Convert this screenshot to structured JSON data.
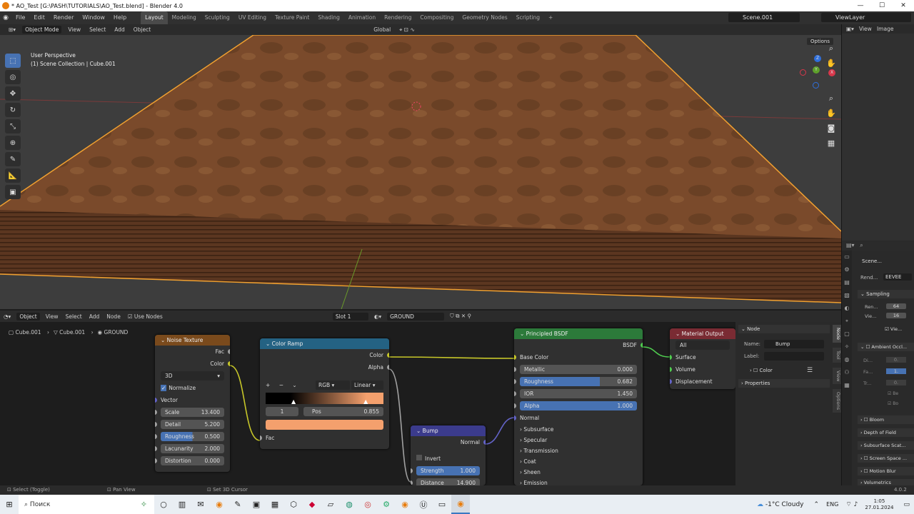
{
  "window": {
    "title": "* AO_Test [G:\\PASH\\TUTORIALS\\AO_Test.blend] - Blender 4.0",
    "min": "—",
    "max": "☐",
    "close": "✕"
  },
  "menu": [
    "File",
    "Edit",
    "Render",
    "Window",
    "Help"
  ],
  "workspaces": [
    "Layout",
    "Modeling",
    "Sculpting",
    "UV Editing",
    "Texture Paint",
    "Shading",
    "Animation",
    "Rendering",
    "Compositing",
    "Geometry Nodes",
    "Scripting",
    "+"
  ],
  "scene": "Scene.001",
  "viewlayer": "ViewLayer",
  "viewport": {
    "mode": "Object Mode",
    "menus": [
      "View",
      "Select",
      "Add",
      "Object"
    ],
    "transform": "Global",
    "options": "Options",
    "perspective": "User Perspective",
    "collection": "(1) Scene Collection | Cube.001"
  },
  "gizmo": {
    "x": "X",
    "y": "Y",
    "z": "Z"
  },
  "nodeeditor": {
    "editor_type": "Object",
    "menus": [
      "View",
      "Select",
      "Add",
      "Node"
    ],
    "use_nodes": "Use Nodes",
    "slot": "Slot 1",
    "material": "GROUND",
    "breadcrumb": [
      "Cube.001",
      "Cube.001",
      "GROUND"
    ]
  },
  "noise": {
    "title": "Noise Texture",
    "out_fac": "Fac",
    "out_color": "Color",
    "dim": "3D",
    "normalize": "Normalize",
    "vector": "Vector",
    "fields": [
      {
        "label": "Scale",
        "value": "13.400"
      },
      {
        "label": "Detail",
        "value": "5.200"
      },
      {
        "label": "Roughness",
        "value": "0.500"
      },
      {
        "label": "Lacunarity",
        "value": "2.000"
      },
      {
        "label": "Distortion",
        "value": "0.000"
      }
    ],
    "roughness_fill": 0.5
  },
  "ramp": {
    "title": "Color Ramp",
    "out_color": "Color",
    "out_alpha": "Alpha",
    "mode": "RGB",
    "interp": "Linear",
    "index": "1",
    "pos_label": "Pos",
    "pos_value": "0.855",
    "in_fac": "Fac",
    "stop_color": "#f4a06d",
    "start_color": "#000000"
  },
  "bump": {
    "title": "Bump",
    "out_normal": "Normal",
    "invert": "Invert",
    "strength_label": "Strength",
    "strength_value": "1.000",
    "distance_label": "Distance",
    "distance_value": "14.900"
  },
  "bsdf": {
    "title": "Principled BSDF",
    "out": "BSDF",
    "base_color": "Base Color",
    "fields": [
      {
        "label": "Metallic",
        "value": "0.000"
      },
      {
        "label": "Roughness",
        "value": "0.682"
      },
      {
        "label": "IOR",
        "value": "1.450"
      },
      {
        "label": "Alpha",
        "value": "1.000"
      }
    ],
    "roughness_fill": 0.682,
    "normal": "Normal",
    "sections": [
      "Subsurface",
      "Specular",
      "Transmission",
      "Coat",
      "Sheen",
      "Emission"
    ]
  },
  "matout": {
    "title": "Material Output",
    "target": "All",
    "sockets": [
      "Surface",
      "Volume",
      "Displacement"
    ]
  },
  "npanel": {
    "section": "Node",
    "name_label": "Name:",
    "name_value": "Bump",
    "label_label": "Label:",
    "color": "Color",
    "properties": "Properties",
    "tabs": [
      "Node",
      "Tool",
      "View",
      "Options"
    ]
  },
  "props": {
    "scene": "Scene...",
    "render_label": "Rend...",
    "engine": "EEVEE",
    "sampling": "Sampling",
    "render_samples_label": "Ren...",
    "render_samples": "64",
    "viewport_samples_label": "Vie...",
    "viewport_samples": "16",
    "denoise": "Vie...",
    "ao": "Ambient Occl...",
    "ao_rows": [
      "Di...",
      "Fa...",
      "Tr..."
    ],
    "ao_vals": [
      "0.",
      "1.",
      "0."
    ],
    "ao_checks": [
      "Be",
      "Bo"
    ],
    "sections": [
      "Bloom",
      "Depth of Field",
      "Subsurface Scat...",
      "Screen Space ...",
      "Motion Blur",
      "Volumetrics"
    ]
  },
  "status": {
    "select": "Select (Toggle)",
    "pan": "Pan View",
    "cursor": "Set 3D Cursor",
    "version": "4.0.2"
  },
  "taskbar": {
    "search": "Поиск",
    "weather": "-1°C  Cloudy",
    "lang": "ENG",
    "time": "1:05",
    "date": "27.01.2024"
  }
}
